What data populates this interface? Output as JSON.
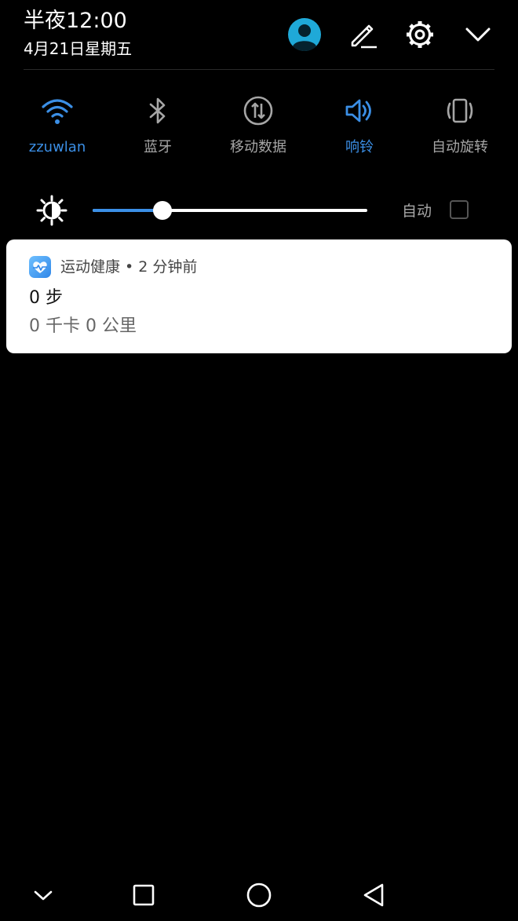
{
  "status": {
    "time": "半夜12:00",
    "date": "4月21日星期五"
  },
  "header_icons": {
    "avatar": "avatar-icon",
    "edit": "edit-pencil-icon",
    "settings": "gear-icon",
    "collapse": "chevron-down-icon"
  },
  "toggles": [
    {
      "label": "zzuwlan",
      "icon": "wifi-icon",
      "active": true
    },
    {
      "label": "蓝牙",
      "icon": "bluetooth-icon",
      "active": false
    },
    {
      "label": "移动数据",
      "icon": "mobile-data-icon",
      "active": false
    },
    {
      "label": "响铃",
      "icon": "speaker-icon",
      "active": true
    },
    {
      "label": "自动旋转",
      "icon": "auto-rotate-icon",
      "active": false
    }
  ],
  "brightness": {
    "level": 0.255,
    "auto_label": "自动",
    "auto_checked": false
  },
  "notification": {
    "header": "运动健康 • 2 分钟前",
    "title": "0 步",
    "body": "0 千卡  0 公里"
  },
  "colors": {
    "accent": "#3b8fe6",
    "background": "#000000",
    "inactive": "#a6a6a6"
  },
  "navbar": {
    "icons": [
      "chevron-down-icon",
      "recent-apps-icon",
      "home-icon",
      "back-icon"
    ]
  }
}
